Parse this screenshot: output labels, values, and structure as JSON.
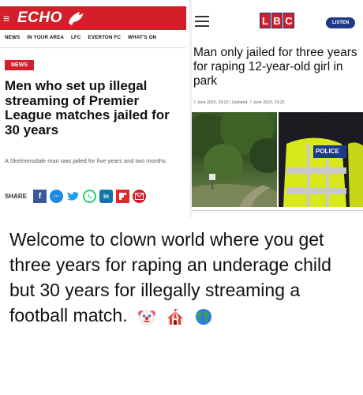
{
  "echo": {
    "logo": "ECHO",
    "nav": [
      "NEWS",
      "IN YOUR AREA",
      "LFC",
      "EVERTON FC",
      "WHAT'S ON"
    ],
    "tag": "NEWS",
    "headline": "Men who set up illegal streaming of Premier League matches jailed for 30 years",
    "standfirst": "A Skelmersdale man was jailed for five years and two months",
    "share_label": "SHARE",
    "share_icons": [
      "facebook-icon",
      "messenger-icon",
      "twitter-icon",
      "whatsapp-icon",
      "linkedin-icon",
      "flipboard-icon",
      "email-icon"
    ],
    "brand_color": "#d31f2a"
  },
  "lbc": {
    "logo_letters": [
      "L",
      "B",
      "C"
    ],
    "listen_label": "LISTEN",
    "headline": "Man only jailed for three years for raping 12-year-old girl in park",
    "dates": "7 June 2023, 19:20 | Updated: 7 June 2023, 19:25",
    "police_label": "POLICE",
    "accent_color": "#1d3a8a"
  },
  "caption": {
    "text": "Welcome to clown world where you get three years for raping an underage child but 30 years for illegally streaming a football match.",
    "emojis": [
      "clown-face-emoji",
      "circus-tent-emoji",
      "globe-emoji"
    ]
  }
}
